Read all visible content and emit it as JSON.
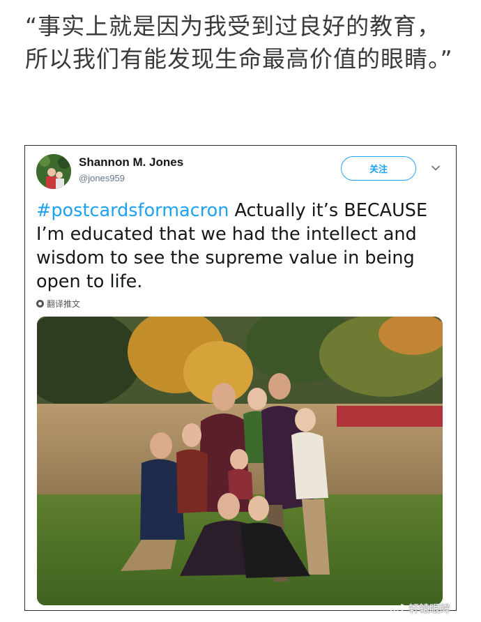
{
  "quote": {
    "text": "“事实上就是因为我受到过良好的教育，所以我们有能发现生命最高价值的眼睛。”"
  },
  "tweet": {
    "display_name": "Shannon M. Jones",
    "handle": "@jones959",
    "follow_label": "关注",
    "hashtag": "#postcardsformacron",
    "body": " Actually it’s BECAUSE I’m educated that we had the intellect and wisdom to see the supreme value in being open to life.",
    "translate_label": "翻译推文"
  },
  "watermark": {
    "text": "轩辕眼眸"
  },
  "colors": {
    "accent": "#1da1f2",
    "name": "#14171a",
    "handle": "#657786"
  }
}
